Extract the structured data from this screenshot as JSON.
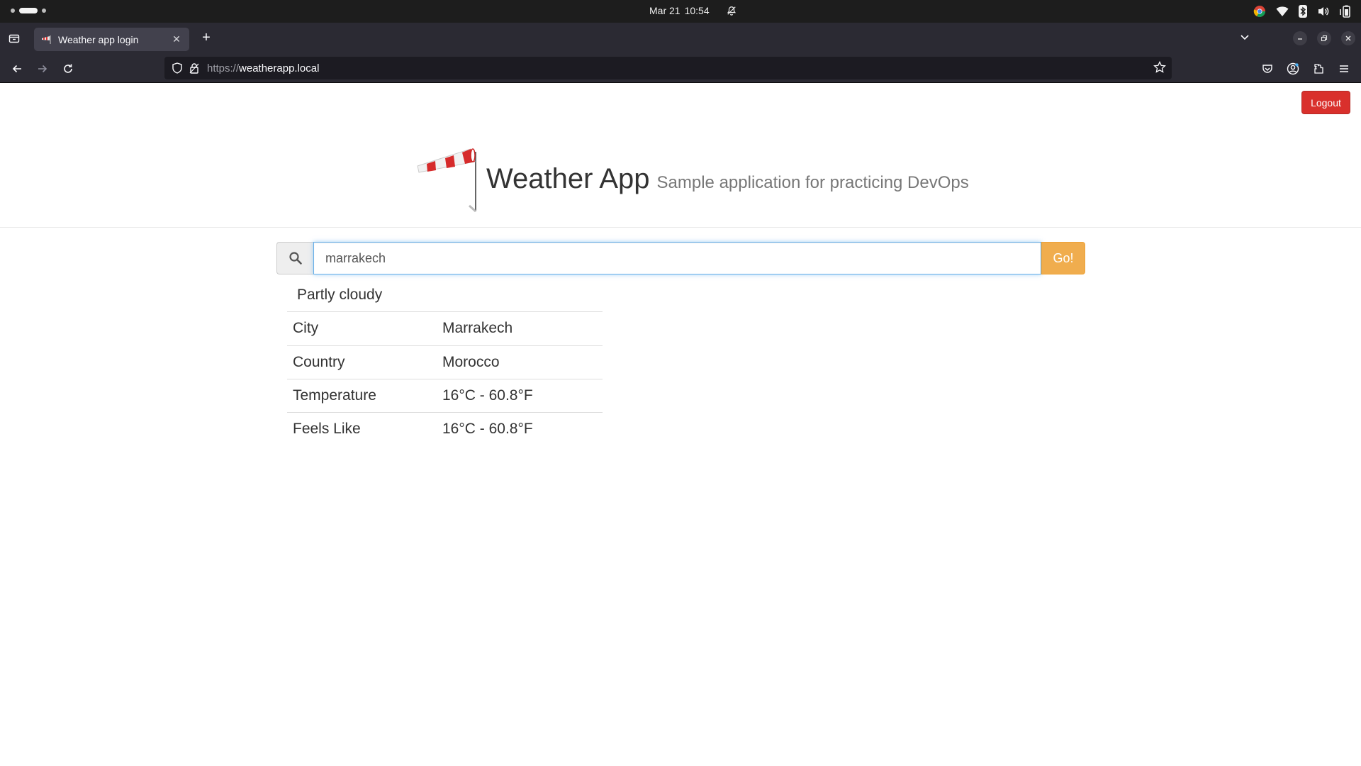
{
  "system_bar": {
    "date": "Mar 21",
    "time": "10:54"
  },
  "browser": {
    "tab": {
      "title": "Weather app login"
    },
    "url": {
      "scheme": "https://",
      "host": "weatherapp.local"
    }
  },
  "page": {
    "logout_label": "Logout",
    "brand": {
      "title": "Weather App",
      "subtitle": "Sample application for practicing DevOps"
    },
    "search": {
      "value": "marrakech",
      "button_label": "Go!"
    },
    "result": {
      "condition": "Partly cloudy",
      "rows": [
        {
          "label": "City",
          "value": "Marrakech"
        },
        {
          "label": "Country",
          "value": "Morocco"
        },
        {
          "label": "Temperature",
          "value": "16°C - 60.8°F"
        },
        {
          "label": "Feels Like",
          "value": "16°C - 60.8°F"
        }
      ]
    }
  },
  "colors": {
    "logout": "#d9302c",
    "go_button": "#f0ad4e",
    "input_focus": "#66afe9"
  },
  "icons": {
    "system": [
      "notifications-off-icon",
      "chrome-icon",
      "wifi-icon",
      "bluetooth-icon",
      "volume-icon",
      "battery-icon"
    ],
    "nav": [
      "back-icon",
      "forward-icon",
      "reload-icon",
      "shield-icon",
      "lock-icon",
      "star-icon",
      "pocket-icon",
      "account-icon",
      "extensions-icon",
      "menu-icon"
    ],
    "page": [
      "windsock-logo",
      "search-icon"
    ]
  }
}
